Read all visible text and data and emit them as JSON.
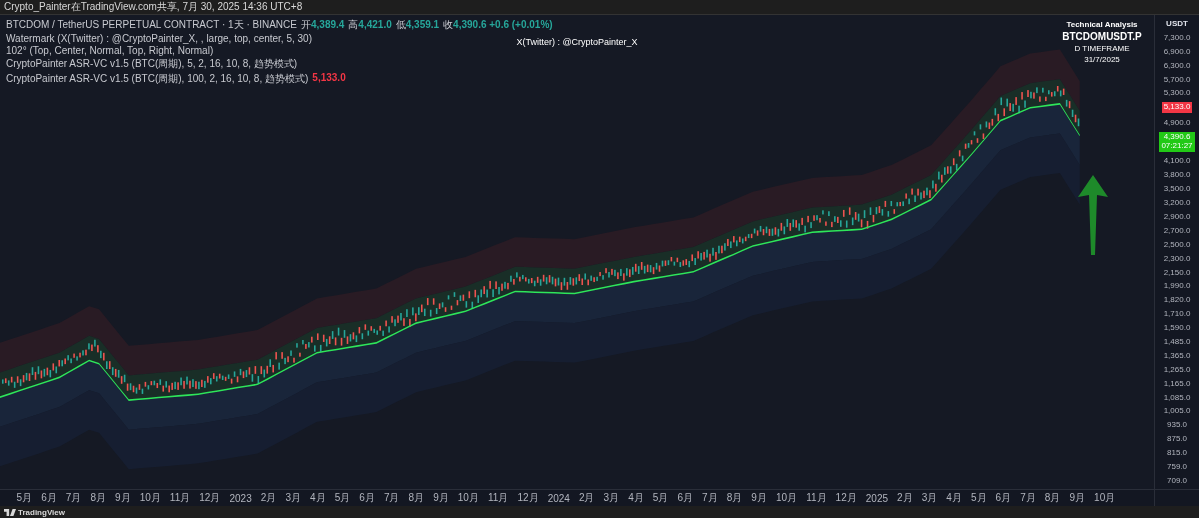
{
  "header": {
    "title": "Crypto_Painter在TradingView.com共享, 7月 30, 2025 14:36 UTC+8"
  },
  "legend": {
    "symbol": "BTCDOM / TetherUS PERPETUAL CONTRACT · 1天 · BINANCE",
    "ohlc": [
      {
        "label": "开",
        "value": "4,389.4"
      },
      {
        "label": "高",
        "value": "4,421.0"
      },
      {
        "label": "低",
        "value": "4,359.1"
      },
      {
        "label": "收",
        "value": "4,390.6 +0.6 (+0.01%)"
      }
    ],
    "indicators": [
      {
        "text": "Watermark (X(Twitter) : @CryptoPainter_X, , large, top, center, 5, 30)"
      },
      {
        "text": "102° (Top, Center, Normal, Top, Right, Normal)"
      },
      {
        "text": "CryptoPainter ASR-VC v1.5 (BTC(周期), 5, 2, 16, 10, 8, 趋势模式)"
      },
      {
        "text": "CryptoPainter ASR-VC v1.5 (BTC(周期), 100, 2, 16, 10, 8, 趋势模式)",
        "value": "5,133.0",
        "color": "#f23645"
      }
    ]
  },
  "watermark": "X(Twitter) : @CryptoPainter_X",
  "analysis": {
    "heading": "Technical Analysis",
    "symbol": "BTCDOMUSDT.P",
    "timeframe": "D TIMEFRAME",
    "date": "31/7/2025"
  },
  "price_axis": {
    "currency": "USDT",
    "ticks": [
      {
        "kind": "tick",
        "label": "7,300.0"
      },
      {
        "kind": "tick",
        "label": "6,900.0"
      },
      {
        "kind": "tick",
        "label": "6,300.0"
      },
      {
        "kind": "tick",
        "label": "5,700.0"
      },
      {
        "kind": "tick",
        "label": "5,300.0"
      },
      {
        "kind": "marker",
        "label": "5,133.0",
        "color": "#f23645"
      },
      {
        "kind": "tick",
        "label": "4,900.0"
      },
      {
        "kind": "marker",
        "label": "4,390.6",
        "sub": "07:21:27",
        "color": "#22c916"
      },
      {
        "kind": "tick",
        "label": "4,100.0"
      },
      {
        "kind": "tick",
        "label": "3,800.0"
      },
      {
        "kind": "tick",
        "label": "3,500.0"
      },
      {
        "kind": "tick",
        "label": "3,200.0"
      },
      {
        "kind": "tick",
        "label": "2,900.0"
      },
      {
        "kind": "tick",
        "label": "2,700.0"
      },
      {
        "kind": "tick",
        "label": "2,500.0"
      },
      {
        "kind": "tick",
        "label": "2,300.0"
      },
      {
        "kind": "tick",
        "label": "2,150.0"
      },
      {
        "kind": "tick",
        "label": "1,990.0"
      },
      {
        "kind": "tick",
        "label": "1,820.0"
      },
      {
        "kind": "tick",
        "label": "1,710.0"
      },
      {
        "kind": "tick",
        "label": "1,590.0"
      },
      {
        "kind": "tick",
        "label": "1,485.0"
      },
      {
        "kind": "tick",
        "label": "1,365.0"
      },
      {
        "kind": "tick",
        "label": "1,265.0"
      },
      {
        "kind": "tick",
        "label": "1,165.0"
      },
      {
        "kind": "tick",
        "label": "1,085.0"
      },
      {
        "kind": "tick",
        "label": "1,005.0"
      },
      {
        "kind": "tick",
        "label": "935.0"
      },
      {
        "kind": "tick",
        "label": "875.0"
      },
      {
        "kind": "tick",
        "label": "815.0"
      },
      {
        "kind": "tick",
        "label": "759.0"
      },
      {
        "kind": "tick",
        "label": "709.0"
      }
    ]
  },
  "time_axis": [
    "5月",
    "6月",
    "7月",
    "8月",
    "9月",
    "10月",
    "11月",
    "12月",
    "2023",
    "2月",
    "3月",
    "4月",
    "5月",
    "6月",
    "7月",
    "8月",
    "9月",
    "10月",
    "11月",
    "12月",
    "2024",
    "2月",
    "3月",
    "4月",
    "5月",
    "6月",
    "7月",
    "8月",
    "9月",
    "10月",
    "11月",
    "12月",
    "2025",
    "2月",
    "3月",
    "4月",
    "5月",
    "6月",
    "7月",
    "8月",
    "9月",
    "10月"
  ],
  "footer": {
    "brand": "TradingView"
  }
}
